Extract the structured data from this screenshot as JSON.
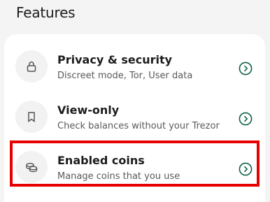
{
  "page": {
    "title": "Features"
  },
  "items": [
    {
      "label": "Privacy & security",
      "description": "Discreet mode, Tor, User data",
      "icon": "lock-icon"
    },
    {
      "label": "View-only",
      "description": "Check balances without your Trezor",
      "icon": "bookmark-icon"
    },
    {
      "label": "Enabled coins",
      "description": "Manage coins that you use",
      "icon": "coins-icon"
    }
  ],
  "colors": {
    "accent": "#0f6148",
    "highlight": "#e60000"
  }
}
